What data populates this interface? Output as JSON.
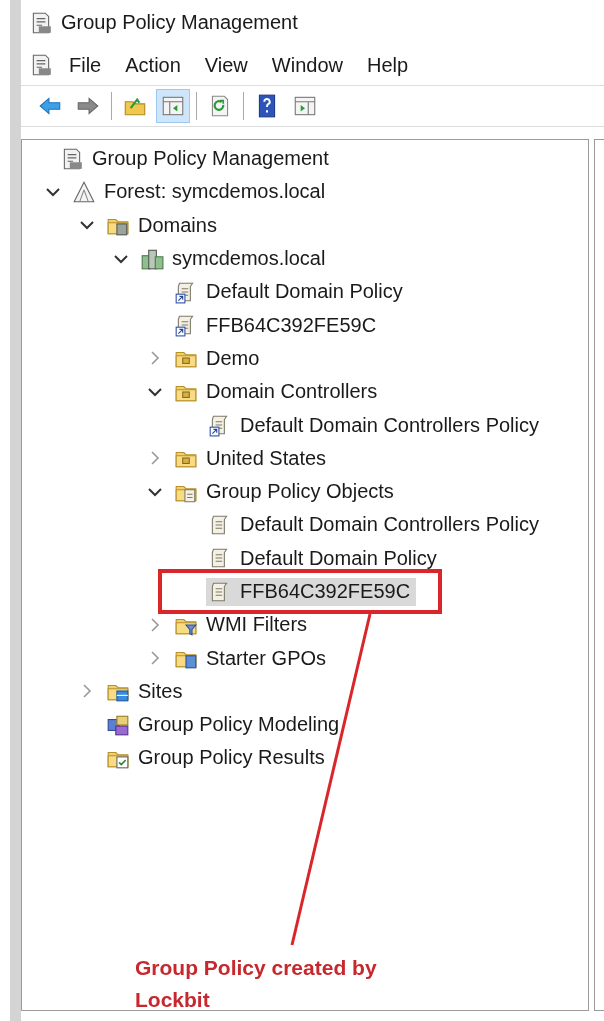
{
  "window": {
    "title": "Group Policy Management"
  },
  "menu": [
    "File",
    "Action",
    "View",
    "Window",
    "Help"
  ],
  "toolbar": [
    {
      "buttons": [
        {
          "kind": "back",
          "pressed": false
        },
        {
          "kind": "forward",
          "pressed": false
        }
      ]
    },
    {
      "buttons": [
        {
          "kind": "up",
          "pressed": false
        },
        {
          "kind": "tree-toggle",
          "pressed": true
        }
      ]
    },
    {
      "buttons": [
        {
          "kind": "refresh",
          "pressed": false
        }
      ]
    },
    {
      "buttons": [
        {
          "kind": "help",
          "pressed": false
        },
        {
          "kind": "action-pane",
          "pressed": false
        }
      ]
    }
  ],
  "tree": [
    {
      "label": "Group Policy Management",
      "kind": "console",
      "selected": false,
      "children": [
        {
          "label": "Forest: symcdemos.local",
          "kind": "forest",
          "expanded": true,
          "selected": false,
          "children": [
            {
              "label": "Domains",
              "kind": "domains",
              "expanded": true,
              "selected": false,
              "children": [
                {
                  "label": "symcdemos.local",
                  "kind": "domain",
                  "expanded": true,
                  "selected": false,
                  "children": [
                    {
                      "label": "Default Domain Policy",
                      "kind": "gpo-link",
                      "selected": false
                    },
                    {
                      "label": "FFB64C392FE59C",
                      "kind": "gpo-link",
                      "selected": false
                    },
                    {
                      "label": "Demo",
                      "kind": "ou",
                      "expanded": false,
                      "selected": false
                    },
                    {
                      "label": "Domain Controllers",
                      "kind": "ou",
                      "expanded": true,
                      "selected": false,
                      "children": [
                        {
                          "label": "Default Domain Controllers Policy",
                          "kind": "gpo-link",
                          "selected": false
                        }
                      ]
                    },
                    {
                      "label": "United States",
                      "kind": "ou",
                      "expanded": false,
                      "selected": false
                    },
                    {
                      "label": "Group Policy Objects",
                      "kind": "gpo-folder",
                      "expanded": true,
                      "selected": false,
                      "children": [
                        {
                          "label": "Default Domain Controllers Policy",
                          "kind": "gpo",
                          "selected": false
                        },
                        {
                          "label": "Default Domain Policy",
                          "kind": "gpo",
                          "selected": false
                        },
                        {
                          "label": "FFB64C392FE59C",
                          "kind": "gpo",
                          "selected": true
                        }
                      ]
                    },
                    {
                      "label": "WMI Filters",
                      "kind": "wmi",
                      "expanded": false,
                      "selected": false
                    },
                    {
                      "label": "Starter GPOs",
                      "kind": "starter",
                      "expanded": false,
                      "selected": false
                    }
                  ]
                }
              ]
            },
            {
              "label": "Sites",
              "kind": "sites",
              "expanded": false,
              "selected": false
            },
            {
              "label": "Group Policy Modeling",
              "kind": "modeling",
              "selected": false
            },
            {
              "label": "Group Policy Results",
              "kind": "results",
              "selected": false
            }
          ]
        }
      ]
    }
  ],
  "callout": {
    "text": "Group Policy created by Lockbit"
  }
}
